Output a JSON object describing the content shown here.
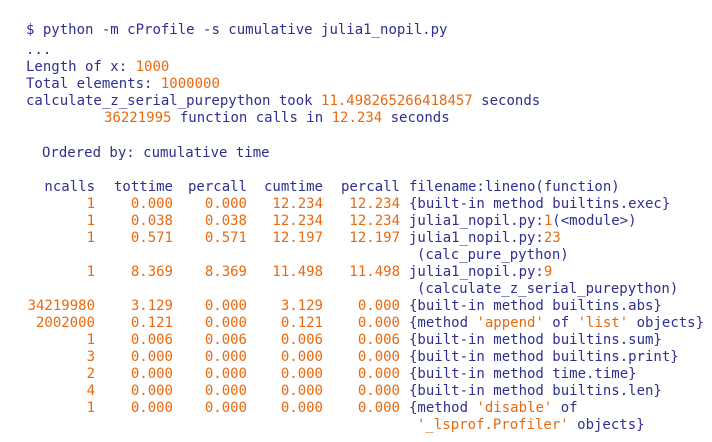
{
  "terminal": {
    "prompt": "$",
    "command": "python -m cProfile -s cumulative julia1_nopil.py",
    "ellipsis": "...",
    "len_label": "Length of x:",
    "len_value": "1000",
    "total_label": "Total elements:",
    "total_value": "1000000",
    "took_prefix": "calculate_z_serial_purepython took",
    "took_value": "11.498265266418457",
    "took_suffix": "seconds",
    "calls_value": "36221995",
    "calls_mid": "function calls in",
    "calls_time": "12.234",
    "calls_suffix": "seconds",
    "ordered": "Ordered by: cumulative time",
    "headers": [
      "ncalls",
      "tottime",
      "percall",
      "cumtime",
      "percall",
      "filename:lineno(function)"
    ],
    "rows": [
      {
        "ncalls": "1",
        "tottime": "0.000",
        "percall": "0.000",
        "cumtime": "12.234",
        "percall2": "12.234",
        "func": "{built-in method builtins.exec}"
      },
      {
        "ncalls": "1",
        "tottime": "0.038",
        "percall": "0.038",
        "cumtime": "12.234",
        "percall2": "12.234",
        "func": "julia1_nopil.py:1(<module>)"
      },
      {
        "ncalls": "1",
        "tottime": "0.571",
        "percall": "0.571",
        "cumtime": "12.197",
        "percall2": "12.197",
        "func": "julia1_nopil.py:23",
        "cont": "(calc_pure_python)"
      },
      {
        "ncalls": "1",
        "tottime": "8.369",
        "percall": "8.369",
        "cumtime": "11.498",
        "percall2": "11.498",
        "func": "julia1_nopil.py:9",
        "cont": "(calculate_z_serial_purepython)"
      },
      {
        "ncalls": "34219980",
        "tottime": "3.129",
        "percall": "0.000",
        "cumtime": "3.129",
        "percall2": "0.000",
        "func": "{built-in method builtins.abs}"
      },
      {
        "ncalls": "2002000",
        "tottime": "0.121",
        "percall": "0.000",
        "cumtime": "0.121",
        "percall2": "0.000",
        "func": "{method 'append' of 'list' objects}"
      },
      {
        "ncalls": "1",
        "tottime": "0.006",
        "percall": "0.006",
        "cumtime": "0.006",
        "percall2": "0.006",
        "func": "{built-in method builtins.sum}"
      },
      {
        "ncalls": "3",
        "tottime": "0.000",
        "percall": "0.000",
        "cumtime": "0.000",
        "percall2": "0.000",
        "func": "{built-in method builtins.print}"
      },
      {
        "ncalls": "2",
        "tottime": "0.000",
        "percall": "0.000",
        "cumtime": "0.000",
        "percall2": "0.000",
        "func": "{built-in method time.time}"
      },
      {
        "ncalls": "4",
        "tottime": "0.000",
        "percall": "0.000",
        "cumtime": "0.000",
        "percall2": "0.000",
        "func": "{built-in method builtins.len}"
      },
      {
        "ncalls": "1",
        "tottime": "0.000",
        "percall": "0.000",
        "cumtime": "0.000",
        "percall2": "0.000",
        "func": "{method 'disable' of",
        "cont": "'_lsprof.Profiler' objects}"
      }
    ]
  }
}
